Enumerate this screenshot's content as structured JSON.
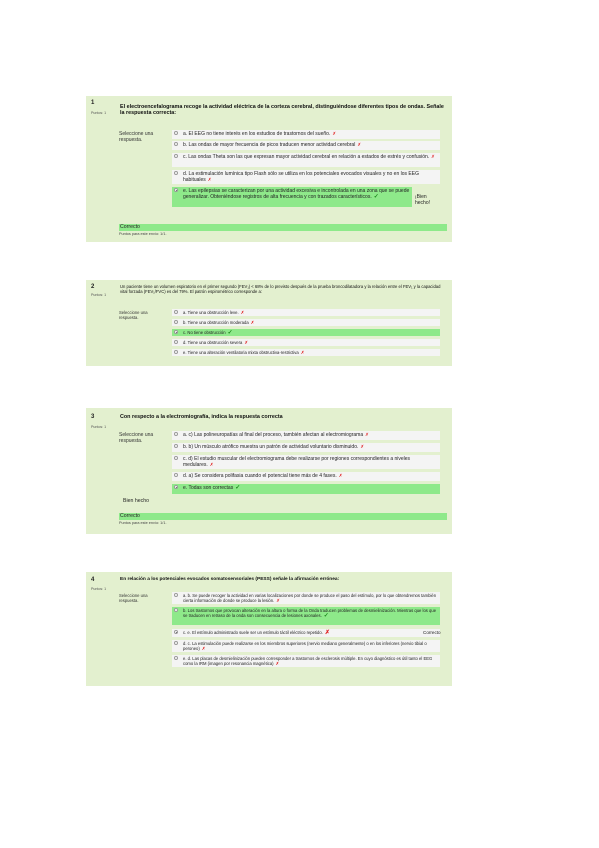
{
  "questions": [
    {
      "number": "1",
      "points": "Puntos: 1",
      "text": "El electroencefalograma recoge la actividad eléctrica de la corteza cerebral, distinguiéndose diferentes tipos de ondas. Señale la respuesta correcta:",
      "select_label": "Seleccione una respuesta.",
      "options": [
        {
          "text": "a. El EEG no tiene interés en los estudios de trastornos del sueño.",
          "mark": "✗"
        },
        {
          "text": "b. Las ondas de mayor frecuencia de picos traducen menor actividad cerebral",
          "mark": "✗"
        },
        {
          "text": "c. Las ondas Theta son las que expresan mayor actividad cerebral en relación a estados de estrés y confusión.",
          "mark": "✗"
        },
        {
          "text": "d. La estimulación lumínica tipo Flash sólo se utiliza en los potenciales evocados visuales y no en los EEG habituales",
          "mark": "✗"
        },
        {
          "text": "e. Las epilepsias se caracterizan por una actividad excesiva e incontrolada en una zona que se puede generalizar. Obteniéndose registros de alta frecuencia y con trazados característicos.",
          "mark": "✓"
        }
      ],
      "side_feedback": "¡Bien hecho!",
      "result": "Correcto",
      "grade": "Puntos para este envío: 1/1."
    },
    {
      "number": "2",
      "points": "Puntos: 1",
      "text": "Un paciente tiene un volumen espiratorio en el primer segundo (FEV₁) < 68% de lo previsto después de la prueba broncodilatadora y la relación entre el FEV₁ y la capacidad vital forzada (FEV₁/FVC) es del 79%. El patrón espirométrico corresponde a:",
      "select_label": "Seleccione una respuesta.",
      "options": [
        {
          "text": "a. Tiene una obstrucción leve.",
          "mark": "✗"
        },
        {
          "text": "b. Tiene una obstrucción moderada",
          "mark": "✗"
        },
        {
          "text": "c. No tiene obstrucción",
          "mark": "✓"
        },
        {
          "text": "d. Tiene una obstrucción severa",
          "mark": "✗"
        },
        {
          "text": "e. Tiene una alteración ventilatoria mixta obstructiva-restrictiva",
          "mark": "✗"
        }
      ]
    },
    {
      "number": "3",
      "points": "Puntos: 1",
      "text": "Con respecto a la electromiografía, indica la respuesta correcta",
      "select_label": "Seleccione una respuesta.",
      "options": [
        {
          "text": "a. c) Las polineuropatías al final del proceso, también afectan al electromiograma",
          "mark": "✗"
        },
        {
          "text": "b. b) Un músculo atrófico muestra un patrón de actividad voluntario disminuido.",
          "mark": "✗"
        },
        {
          "text": "c. d) El estudio muscular del electromiograma debe realizarse por regiones correspondientes a niveles medulares.",
          "mark": "✗"
        },
        {
          "text": "d. a) Se considera polifasia cuando el potencial tiene más de 4 fases.",
          "mark": "✗"
        },
        {
          "text": "e. Todas son correctas",
          "mark": "✓"
        }
      ],
      "below_feedback": "Bien hecho",
      "result": "Correcto",
      "grade": "Puntos para este envío: 1/1."
    },
    {
      "number": "4",
      "points": "Puntos: 1",
      "text": "En relación a los potenciales evocados somatosensoriales (PESS) señale la afirmación errónea:",
      "select_label": "Seleccione una respuesta.",
      "options": [
        {
          "text": "a. b. Se puede recoger la actividad en varias localizaciones por donde se produce el paso del estímulo, por lo que obtendremos también cierta información de donde se produce la lesión.",
          "mark": "✗"
        },
        {
          "text": "b. Los trastornos que provocan alteración en la altura o forma de la Onda traducen problemas de desmielinización. Mientras que los que se traducen en retraso de la onda son consecuencia de lesiones axonales.",
          "mark": "✓"
        },
        {
          "text": "c. e. El estímulo administrado suele ser un estímulo táctil eléctrico repetido.",
          "mark": "✗"
        },
        {
          "text": "d. c. La estimulación puede realizarse en los miembros superiores (nervio mediano generalmente) o en los inferiores (nervio tibial o peroneo)",
          "mark": "✗"
        },
        {
          "text": "e. d. Las placas de desmielinización pueden corresponder a trastornos de esclerosis múltiple. En cuyo diagnóstico es útil tanto el EEG como la IRM (imagen por resonancia magnética)",
          "mark": "✗"
        }
      ],
      "side_feedback": "Correcto"
    }
  ]
}
